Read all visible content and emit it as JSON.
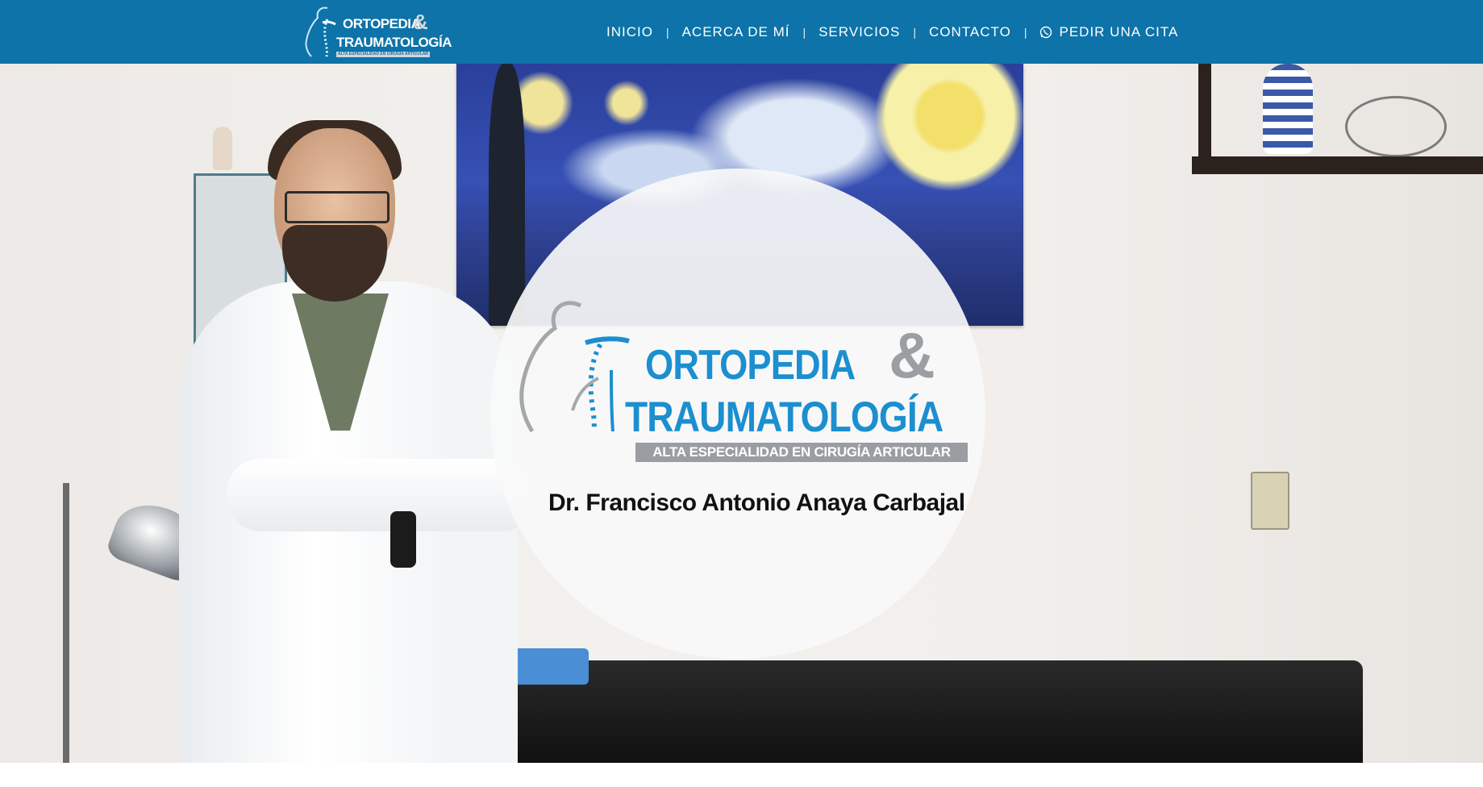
{
  "header": {
    "logo": {
      "line1": "ORTOPEDIA",
      "ampersand": "&",
      "line2": "TRAUMATOLOGÍA",
      "tagline": "ALTA ESPECIALIDAD EN CIRUGÍA ARTICULAR"
    },
    "nav": {
      "items": [
        {
          "label": "INICIO"
        },
        {
          "label": "ACERCA DE MÍ"
        },
        {
          "label": "SERVICIOS"
        },
        {
          "label": "CONTACTO"
        },
        {
          "label": "PEDIR UNA CITA",
          "icon": "whatsapp-icon"
        }
      ],
      "separator": "|"
    }
  },
  "hero": {
    "logo": {
      "line1": "ORTOPEDIA",
      "ampersand": "&",
      "line2": "TRAUMATOLOGÍA",
      "tagline": "ALTA ESPECIALIDAD EN CIRUGÍA ARTICULAR"
    },
    "doctor_name": "Dr. Francisco Antonio Anaya Carbajal"
  },
  "colors": {
    "nav_background": "#0d73a8",
    "brand_blue": "#1b8fd0",
    "brand_gray": "#9a9da1"
  }
}
